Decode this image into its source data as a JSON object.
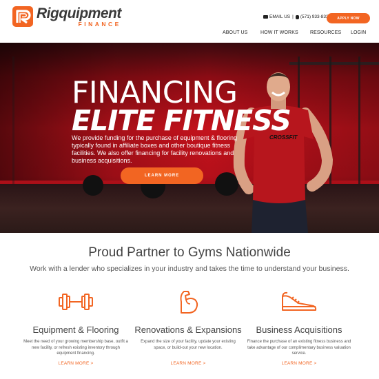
{
  "header": {
    "logo_name": "Rigquipment",
    "logo_sub": "FINANCE",
    "email_label": "EMAIL US",
    "phone": "(571) 933-8339",
    "apply_label": "APPLY NOW"
  },
  "nav": {
    "items": [
      {
        "label": "ABOUT US"
      },
      {
        "label": "HOW IT WORKS"
      },
      {
        "label": "RESOURCES"
      },
      {
        "label": "LOGIN"
      }
    ]
  },
  "hero": {
    "title_line1": "FINANCING",
    "title_line2": "ELITE FITNESS",
    "description": "We provide funding for the purchase of equipment & flooring typically found in affiliate boxes and other boutique fitness facilities. We also offer financing for facility renovations and business acquisitions.",
    "cta_label": "LEARN MORE",
    "shirt_text": "CROSSFIT"
  },
  "partner": {
    "title": "Proud Partner to Gyms Nationwide",
    "subtitle": "Work with a lender who specializes in your industry and takes the time to understand your business."
  },
  "features": [
    {
      "icon": "dumbbell-icon",
      "title": "Equipment & Flooring",
      "description": "Meet the need of your growing membership base, outfit a new facility, or refresh existing inventory through equipment financing.",
      "link": "LEARN MORE >"
    },
    {
      "icon": "flexed-arm-icon",
      "title": "Renovations & Expansions",
      "description": "Expand the size of your facility, update your existing space, or build-out your new location.",
      "link": "LEARN MORE >"
    },
    {
      "icon": "sneaker-icon",
      "title": "Business Acquisitions",
      "description": "Finance the purchase of an existing fitness business and take advantage of our complimentary business valuation service.",
      "link": "LEARN MORE >"
    }
  ],
  "colors": {
    "accent": "#f26522",
    "hero_red": "#c4121c",
    "text_dark": "#444444"
  }
}
